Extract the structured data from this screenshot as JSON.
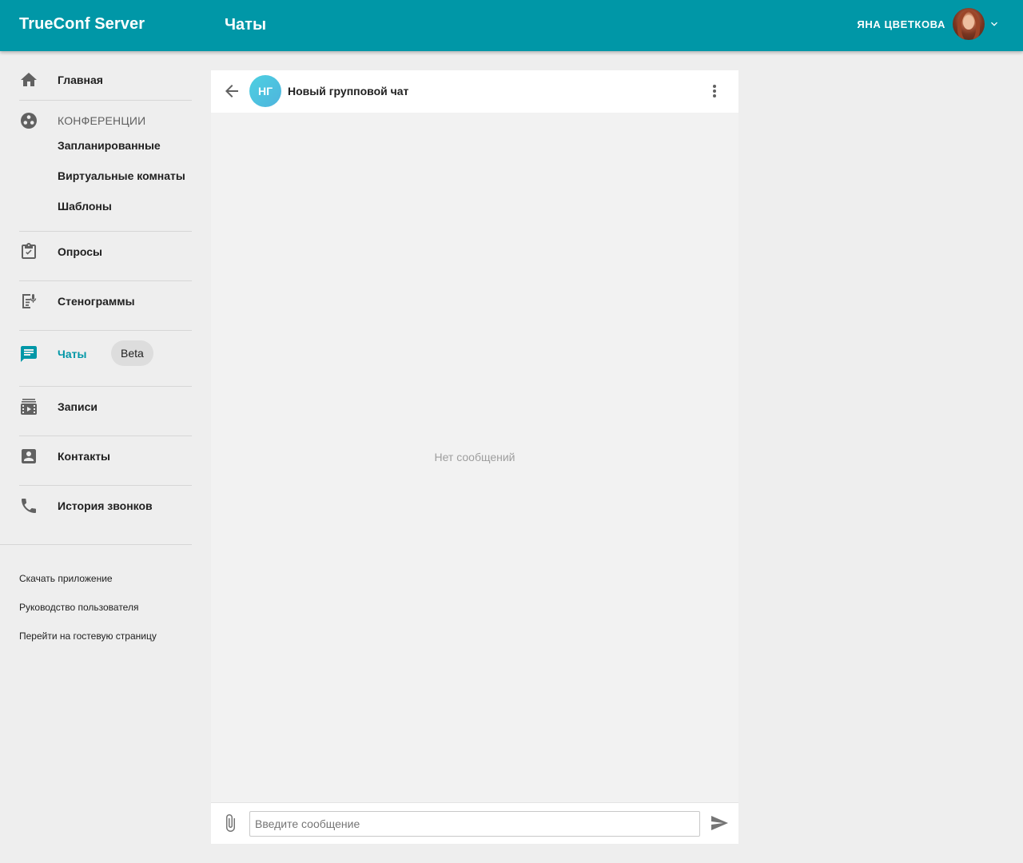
{
  "header": {
    "app_title": "TrueConf Server",
    "page_title": "Чаты",
    "user_name": "ЯНА ЦВЕТКОВА",
    "accent_color": "#0097a7"
  },
  "sidebar": {
    "home": "Главная",
    "conferences": {
      "label": "КОНФЕРЕНЦИИ",
      "items": [
        "Запланированные",
        "Виртуальные комнаты",
        "Шаблоны"
      ]
    },
    "polls": "Опросы",
    "transcripts": "Стенограммы",
    "chats": "Чаты",
    "chats_badge": "Beta",
    "recordings": "Записи",
    "contacts": "Контакты",
    "call_history": "История звонков",
    "footer_links": [
      "Скачать приложение",
      "Руководство пользователя",
      "Перейти на гостевую страницу"
    ]
  },
  "chat": {
    "avatar_initials": "НГ",
    "title": "Новый групповой чат",
    "empty_text": "Нет сообщений",
    "input_placeholder": "Введите сообщение",
    "input_value": ""
  },
  "icons": [
    "home-icon",
    "conferences-icon",
    "clipboard-check-icon",
    "transcript-icon",
    "chat-icon",
    "recordings-icon",
    "contact-card-icon",
    "phone-icon",
    "chevron-down-icon",
    "back-arrow-icon",
    "more-vert-icon",
    "attach-icon",
    "send-icon"
  ]
}
